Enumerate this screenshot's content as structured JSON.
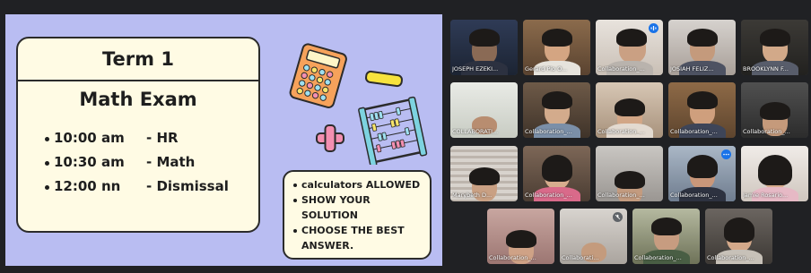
{
  "slide": {
    "term_title": "Term 1",
    "exam_title": "Math Exam",
    "schedule": [
      {
        "time": "10:00 am",
        "activity": "- HR"
      },
      {
        "time": "10:30 am",
        "activity": "- Math"
      },
      {
        "time": "12:00 nn",
        "activity": "- Dismissal"
      }
    ],
    "rules": {
      "r1": "calculators ALLOWED",
      "r2a": "SHOW YOUR",
      "r2b": "SOLUTION",
      "r3a": "CHOOSE THE BEST",
      "r3b": "ANSWER."
    }
  },
  "participants": {
    "p1": "JOSEPH EZEKI...",
    "p2": "Gerard Pio O...",
    "p3": "Collaboration_...",
    "p4": "JOSIAH FELIZ...",
    "p5": "BROOKLYNN F...",
    "p6": "COLLABORATI...",
    "p7": "Collaboration_...",
    "p8": "Collaboration_...",
    "p9": "Collaboration_...",
    "p10": "Collaboration_...",
    "p11": "Marybeth D...",
    "p12": "Collaboration_...",
    "p13": "Collaboration_...",
    "p14": "Collaboration_...",
    "p15": "Jamie Rosario...",
    "p16": "Collaboration_...",
    "p17": "Collaborati...",
    "p18": "Collaboration_...",
    "p19": "Collaboration_..."
  },
  "colors": {
    "slide_bg": "#b9bdf2",
    "card_bg": "#fffbe4",
    "meeting_bg": "#202124",
    "speaking_badge": "#1a73e8"
  }
}
